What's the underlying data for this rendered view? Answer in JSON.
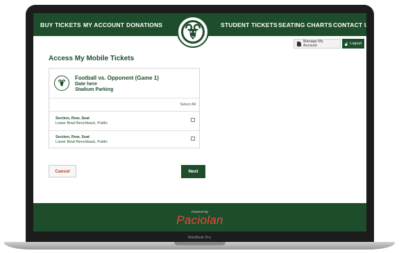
{
  "nav": {
    "buy_tickets": "BUY TICKETS",
    "my_account": "MY ACCOUNT",
    "donations": "DONATIONS",
    "student_tickets": "STUDENT TICKETS",
    "seating_charts": "SEATING CHARTS",
    "contact_us": "CONTACT US"
  },
  "account": {
    "manage_label": "Manage My Account",
    "logout_label": "Logout"
  },
  "page": {
    "title": "Access My Mobile Tickets"
  },
  "event": {
    "name": "Football vs. Opponent (Game 1)",
    "date": "Date here",
    "venue": "Stadium Parking"
  },
  "tickets": {
    "select_all_label": "Select All",
    "rows": [
      {
        "title": "Section, Row, Seat",
        "detail": "Lower Bowl Benchback, Public"
      },
      {
        "title": "Section, Row, Seat",
        "detail": "Lower Bowl Benchback, Public"
      }
    ]
  },
  "actions": {
    "cancel_label": "Cancel",
    "next_label": "Next"
  },
  "footer": {
    "powered_by": "Powered By",
    "brand": "Paciolan"
  },
  "device": {
    "model": "MacBook Pro"
  },
  "colors": {
    "brand_green": "#1e4d2b",
    "cancel_red": "#c0392b",
    "paciolan_red": "#e74c3c"
  }
}
